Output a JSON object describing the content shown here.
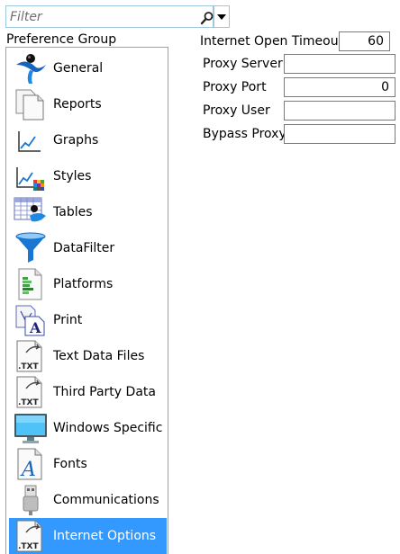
{
  "filter": {
    "placeholder": "Filter",
    "value": ""
  },
  "preference_group": {
    "heading": "Preference Group",
    "items": [
      {
        "label": "General"
      },
      {
        "label": "Reports"
      },
      {
        "label": "Graphs"
      },
      {
        "label": "Styles"
      },
      {
        "label": "Tables"
      },
      {
        "label": "DataFilter"
      },
      {
        "label": "Platforms"
      },
      {
        "label": "Print"
      },
      {
        "label": "Text Data Files"
      },
      {
        "label": "Third Party Data"
      },
      {
        "label": "Windows Specific"
      },
      {
        "label": "Fonts"
      },
      {
        "label": "Communications"
      },
      {
        "label": "Internet Options"
      }
    ],
    "selected": "Internet Options"
  },
  "internet_options": {
    "timeout_label": "Internet Open Timeout",
    "timeout_value": "60",
    "proxy_server_label": "Proxy Server",
    "proxy_server_value": "",
    "proxy_port_label": "Proxy Port",
    "proxy_port_value": "0",
    "proxy_user_label": "Proxy User",
    "proxy_user_value": "",
    "bypass_proxy_label": "Bypass Proxy",
    "bypass_proxy_value": ""
  },
  "icons": {
    "General": "general-icon",
    "Reports": "reports-icon",
    "Graphs": "graphs-icon",
    "Styles": "styles-icon",
    "Tables": "tables-icon",
    "DataFilter": "funnel-icon",
    "Platforms": "platforms-icon",
    "Print": "print-icon",
    "Text Data Files": "txt-file-icon",
    "Third Party Data": "txt-file-icon",
    "Windows Specific": "monitor-icon",
    "Fonts": "fonts-icon",
    "Communications": "usb-icon",
    "Internet Options": "txt-file-icon"
  },
  "colors": {
    "selection": "#3399ff",
    "filter_border": "#9ec6dc"
  }
}
